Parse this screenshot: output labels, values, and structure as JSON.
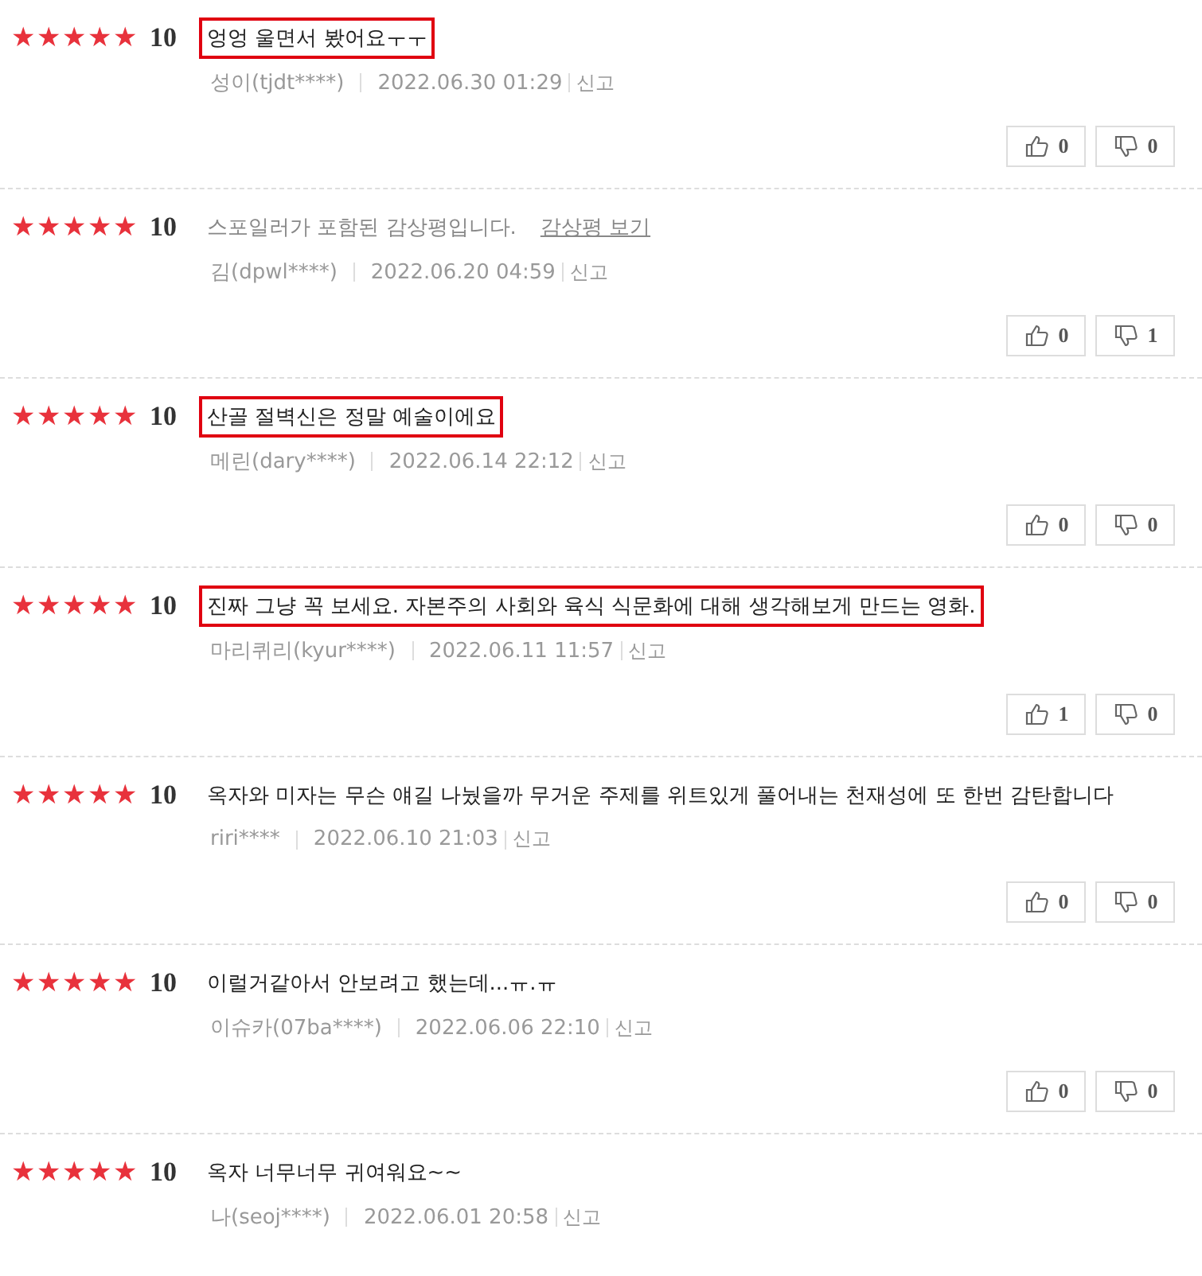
{
  "reviews": [
    {
      "stars": 5,
      "score": "10",
      "kind": "text",
      "text": "엉엉 울면서 봤어요ㅜㅜ",
      "highlighted": true,
      "author": "성이(tjdt****)",
      "date": "2022.06.30 01:29",
      "report": "신고",
      "likes": "0",
      "dislikes": "0"
    },
    {
      "stars": 5,
      "score": "10",
      "kind": "spoiler",
      "text": "스포일러가 포함된 감상평입니다.",
      "link": "감상평 보기",
      "highlighted": false,
      "author": "김(dpwl****)",
      "date": "2022.06.20 04:59",
      "report": "신고",
      "likes": "0",
      "dislikes": "1"
    },
    {
      "stars": 5,
      "score": "10",
      "kind": "text",
      "text": "산골 절벽신은 정말 예술이에요",
      "highlighted": true,
      "author": "메린(dary****)",
      "date": "2022.06.14 22:12",
      "report": "신고",
      "likes": "0",
      "dislikes": "0"
    },
    {
      "stars": 5,
      "score": "10",
      "kind": "text",
      "text": "진짜 그냥 꼭 보세요. 자본주의 사회와 육식 식문화에 대해 생각해보게 만드는 영화.",
      "highlighted": true,
      "author": "마리퀴리(kyur****)",
      "date": "2022.06.11 11:57",
      "report": "신고",
      "likes": "1",
      "dislikes": "0"
    },
    {
      "stars": 5,
      "score": "10",
      "kind": "text",
      "text": "옥자와 미자는 무슨 얘길 나눴을까 무거운 주제를 위트있게 풀어내는 천재성에 또 한번 감탄합니다",
      "highlighted": false,
      "author": "riri****",
      "date": "2022.06.10 21:03",
      "report": "신고",
      "likes": "0",
      "dislikes": "0"
    },
    {
      "stars": 5,
      "score": "10",
      "kind": "text",
      "text": "이럴거같아서 안보려고 했는데...ㅠ.ㅠ",
      "highlighted": false,
      "author": "이슈카(07ba****)",
      "date": "2022.06.06 22:10",
      "report": "신고",
      "likes": "0",
      "dislikes": "0"
    },
    {
      "stars": 5,
      "score": "10",
      "kind": "text",
      "text": "옥자 너무너무 귀여워요~~",
      "highlighted": false,
      "author": "나(seoj****)",
      "date": "2022.06.01 20:58",
      "report": "신고"
    }
  ]
}
